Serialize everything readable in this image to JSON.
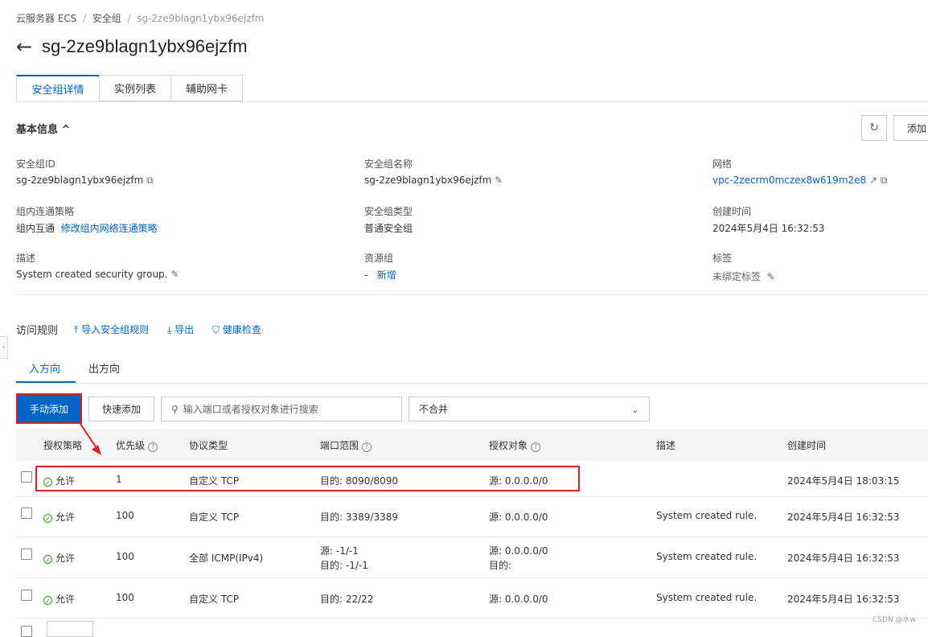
{
  "breadcrumb": [
    "云服务器 ECS",
    "安全组",
    "sg-2ze9blagn1ybx96ejzfm"
  ],
  "page_title": "sg-2ze9blagn1ybx96ejzfm",
  "tabs": [
    "安全组详情",
    "实例列表",
    "辅助网卡"
  ],
  "basic_info": {
    "heading": "基本信息",
    "add_button": "添加",
    "fields": {
      "sg_id_label": "安全组ID",
      "sg_id_value": "sg-2ze9blagn1ybx96ejzfm",
      "sg_name_label": "安全组名称",
      "sg_name_value": "sg-2ze9blagn1ybx96ejzfm",
      "network_label": "网络",
      "network_value": "vpc-2zecrm0mczex8w619m2e8",
      "policy_label": "组内连通策略",
      "policy_value": "组内互通",
      "policy_link": "修改组内网络连通策略",
      "type_label": "安全组类型",
      "type_value": "普通安全组",
      "created_label": "创建时间",
      "created_value": "2024年5月4日 16:32:53",
      "desc_label": "描述",
      "desc_value": "System created security group.",
      "rg_label": "资源组",
      "rg_value": "-",
      "rg_link": "新增",
      "tag_label": "标签",
      "tag_value": "未绑定标签"
    }
  },
  "rules": {
    "heading": "访问规则",
    "import_label": "导入安全组规则",
    "export_label": "导出",
    "health_label": "健康检查",
    "direction_tabs": [
      "入方向",
      "出方向"
    ],
    "manual_add": "手动添加",
    "quick_add": "快速添加",
    "search_placeholder": "输入端口或者授权对象进行搜索",
    "merge_select": "不合并",
    "columns": [
      "授权策略",
      "优先级",
      "协议类型",
      "端口范围",
      "授权对象",
      "描述",
      "创建时间"
    ],
    "rows": [
      {
        "policy": "允许",
        "priority": "1",
        "protocol": "自定义 TCP",
        "port1": "目的: 8090/8090",
        "port2": "",
        "auth1": "源: 0.0.0.0/0",
        "auth2": "",
        "desc": "",
        "created": "2024年5月4日 18:03:15"
      },
      {
        "policy": "允许",
        "priority": "100",
        "protocol": "自定义 TCP",
        "port1": "目的: 3389/3389",
        "port2": "",
        "auth1": "源: 0.0.0.0/0",
        "auth2": "",
        "desc": "System created rule.",
        "created": "2024年5月4日 16:32:53"
      },
      {
        "policy": "允许",
        "priority": "100",
        "protocol": "全部 ICMP(IPv4)",
        "port1": "源: -1/-1",
        "port2": "目的: -1/-1",
        "auth1": "源: 0.0.0.0/0",
        "auth2": "目的:",
        "desc": "System created rule.",
        "created": "2024年5月4日 16:32:53"
      },
      {
        "policy": "允许",
        "priority": "100",
        "protocol": "自定义 TCP",
        "port1": "目的: 22/22",
        "port2": "",
        "auth1": "源: 0.0.0.0/0",
        "auth2": "",
        "desc": "System created rule.",
        "created": "2024年5月4日 16:32:53"
      }
    ]
  },
  "watermark": "CSDN @水w",
  "colors": {
    "accent": "#0064c8",
    "highlight": "#e02020",
    "allow": "#2ea121"
  }
}
